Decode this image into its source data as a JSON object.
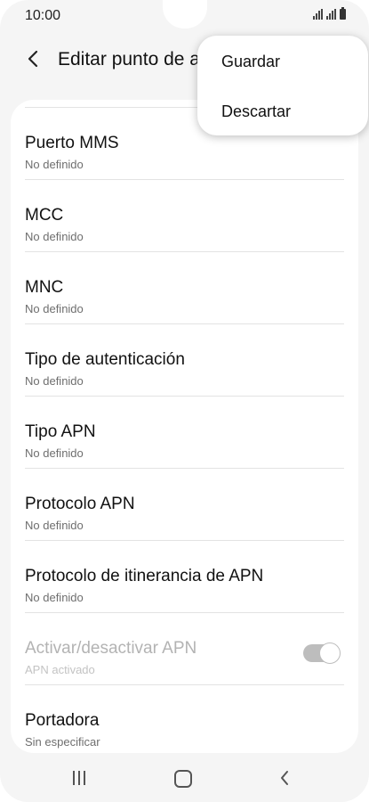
{
  "status_bar": {
    "time": "10:00"
  },
  "header": {
    "title": "Editar punto de a"
  },
  "menu": {
    "items": [
      "Guardar",
      "Descartar"
    ]
  },
  "settings": [
    {
      "label": "Puerto MMS",
      "value": "No definido"
    },
    {
      "label": "MCC",
      "value": "No definido"
    },
    {
      "label": "MNC",
      "value": "No definido"
    },
    {
      "label": "Tipo de autenticación",
      "value": "No definido"
    },
    {
      "label": "Tipo APN",
      "value": "No definido"
    },
    {
      "label": "Protocolo APN",
      "value": "No definido"
    },
    {
      "label": "Protocolo de itinerancia de APN",
      "value": "No definido"
    },
    {
      "label": "Activar/desactivar APN",
      "value": "APN activado",
      "disabled": true,
      "toggle_on": true
    },
    {
      "label": "Portadora",
      "value": "Sin especificar"
    }
  ],
  "icons": {
    "back": "chevron-left-icon",
    "nav_recent": "recent-apps-icon",
    "nav_home": "home-icon",
    "nav_back": "back-icon"
  },
  "colors": {
    "background": "#f5f5f5",
    "card": "#ffffff",
    "disabled_text": "#b3b3b3"
  }
}
